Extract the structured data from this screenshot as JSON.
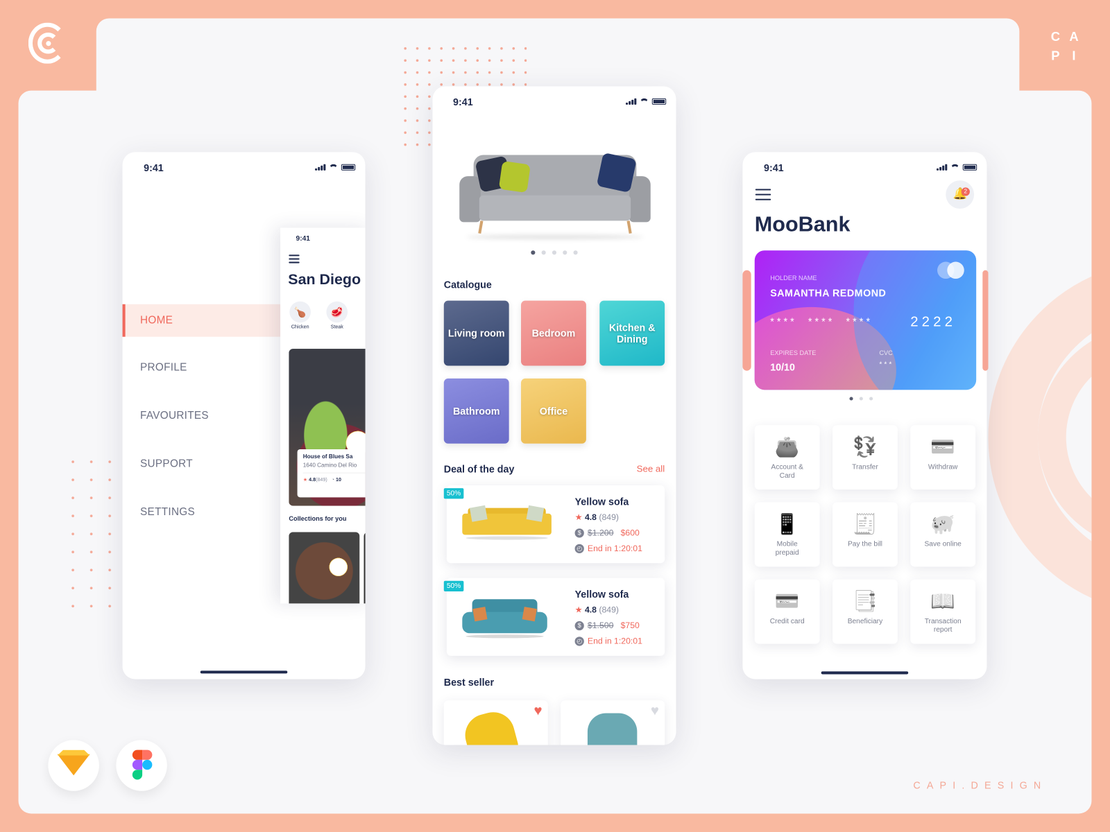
{
  "brand": {
    "logo": "capi-logo",
    "letters": [
      "C",
      "A",
      "P",
      "I"
    ],
    "footer": "CAPI.DESIGN",
    "tools": [
      "sketch-icon",
      "figma-icon"
    ]
  },
  "colors": {
    "background": "#f9b9a0",
    "accent": "#f0685c",
    "navy": "#1f2a4d",
    "teal": "#18c0d0"
  },
  "phone1": {
    "time": "9:41",
    "menu": [
      {
        "label": "HOME",
        "active": true
      },
      {
        "label": "PROFILE"
      },
      {
        "label": "FAVOURITES"
      },
      {
        "label": "SUPPORT"
      },
      {
        "label": "SETTINGS"
      }
    ],
    "inner": {
      "time": "9:41",
      "city": "San Diego",
      "categories": [
        "Chicken",
        "Steak"
      ],
      "restaurant": {
        "name": "House of Blues Sa",
        "address": "1640 Camino Del Rio",
        "rating": "4.8",
        "reviews": "(849)",
        "time": "10"
      },
      "collections": "Collections for you"
    }
  },
  "phone2": {
    "time": "9:41",
    "carousel": {
      "pages": 5,
      "active": 0
    },
    "catalogue_title": "Catalogue",
    "catalogue": [
      "Living room",
      "Bedroom",
      "Kitchen & Dining",
      "Bathroom",
      "Office"
    ],
    "deal_title": "Deal of the day",
    "see_all": "See all",
    "deals": [
      {
        "badge": "50%",
        "name": "Yellow sofa",
        "rating": "4.8",
        "reviews": "(849)",
        "old_price": "$1.200",
        "price": "$600",
        "ends": "End in 1:20:01"
      },
      {
        "badge": "50%",
        "name": "Yellow sofa",
        "rating": "4.8",
        "reviews": "(849)",
        "old_price": "$1.500",
        "price": "$750",
        "ends": "End in 1:20:01"
      }
    ],
    "best_seller_title": "Best seller",
    "best_sellers": [
      {
        "favourite": true
      },
      {
        "favourite": false
      }
    ]
  },
  "phone3": {
    "time": "9:41",
    "app_title": "MooBank",
    "notifications": "2",
    "card": {
      "holder_label": "HOLDER NAME",
      "holder": "SAMANTHA REDMOND",
      "number_mask": "****  ****  ****",
      "number_last": "2222",
      "expires_label": "EXPIRES DATE",
      "expires": "10/10",
      "cvc_label": "CVC",
      "cvc": "***"
    },
    "card_pages": {
      "pages": 3,
      "active": 0
    },
    "services": [
      {
        "label": "Account & Card",
        "icon": "wallet-icon",
        "glyph": "👛"
      },
      {
        "label": "Transfer",
        "icon": "transfer-icon",
        "glyph": "💱"
      },
      {
        "label": "Withdraw",
        "icon": "withdraw-icon",
        "glyph": "💳"
      },
      {
        "label": "Mobile prepaid",
        "icon": "mobile-icon",
        "glyph": "📱"
      },
      {
        "label": "Pay the bill",
        "icon": "bill-icon",
        "glyph": "🧾"
      },
      {
        "label": "Save online",
        "icon": "piggy-bank-icon",
        "glyph": "🐖"
      },
      {
        "label": "Credit card",
        "icon": "credit-card-icon",
        "glyph": "💳"
      },
      {
        "label": "Beneficiary",
        "icon": "beneficiary-icon",
        "glyph": "📑"
      },
      {
        "label": "Transaction report",
        "icon": "report-icon",
        "glyph": "📖"
      }
    ]
  }
}
